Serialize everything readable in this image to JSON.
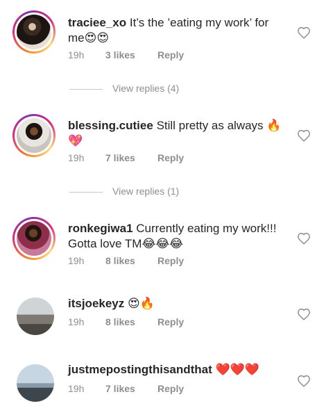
{
  "comments": [
    {
      "username": "traciee_xo",
      "text": "It’s the ’eating my work’ for me😍😍",
      "time": "19h",
      "likes": "3 likes",
      "reply": "Reply",
      "view_replies": "View replies (4)"
    },
    {
      "username": "blessing.cutiee",
      "text": "Still pretty as always 🔥💖",
      "time": "19h",
      "likes": "7 likes",
      "reply": "Reply",
      "view_replies": "View replies (1)"
    },
    {
      "username": "ronkegiwa1",
      "text": "Currently eating my work!!! Gotta love TM😂😂😂",
      "time": "19h",
      "likes": "8 likes",
      "reply": "Reply"
    },
    {
      "username": "itsjoekeyz",
      "text": "😍🔥",
      "time": "19h",
      "likes": "8 likes",
      "reply": "Reply"
    },
    {
      "username": "justmepostingthisandthat",
      "text": "❤️❤️❤️",
      "time": "19h",
      "likes": "7 likes",
      "reply": "Reply"
    }
  ],
  "icons": {
    "like": "heart-outline-icon"
  },
  "colors": {
    "ring_start": "#f58529",
    "ring_mid": "#dd2a7b",
    "ring_end": "#8134af",
    "meta": "#8e8e8e"
  }
}
